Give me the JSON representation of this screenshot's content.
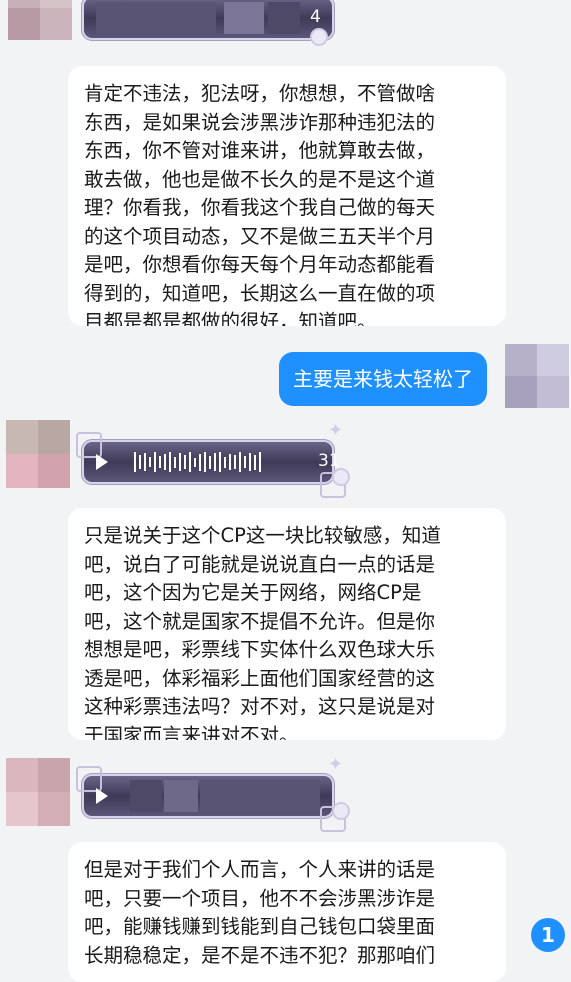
{
  "voice_messages": [
    {
      "duration": "4"
    },
    {
      "duration": "31"
    },
    {
      "duration": ""
    }
  ],
  "messages": [
    "肯定不违法，犯法呀，你想想，不管做啥\n东西，是如果说会涉黑涉诈那种违犯法的\n东西，你不管对谁来讲，他就算敢去做，\n敢去做，他也是做不长久的是不是这个道\n理？你看我，你看我这个我自己做的每天\n的这个项目动态，又不是做三五天半个月\n是吧，你想看你每天每个月年动态都能看\n得到的，知道吧，长期这么一直在做的项\n目都是都是都做的很好，知道吧。",
    "主要是来钱太轻松了",
    "只是说关于这个CP这一块比较敏感，知道\n吧，说白了可能就是说说直白一点的话是\n吧，这个因为它是关于网络，网络CP是\n吧，这个就是国家不提倡不允许。但是你\n想想是吧，彩票线下实体什么双色球大乐\n透是吧，体彩福彩上面他们国家经营的这\n这种彩票违法吗？对不对，这只是说是对\n于国家而言来讲对不对。",
    "但是对于我们个人而言，个人来讲的话是\n吧，只要一个项目，他不不会涉黑涉诈是\n吧，能赚钱赚到钱能到自己钱包口袋里面\n长期稳稳定，是不是不违不犯？那那咱们"
  ],
  "unread_badge": "1",
  "colors": {
    "background": "#f2f3f5",
    "my_bubble": "#1e90ff",
    "their_bubble": "#ffffff"
  }
}
